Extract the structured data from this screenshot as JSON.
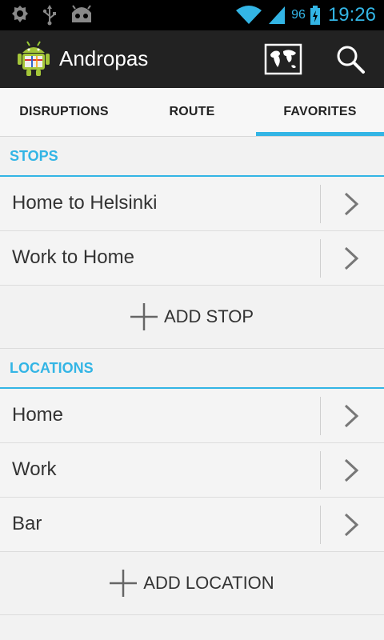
{
  "status_bar": {
    "icons": [
      "settings-gear-icon",
      "usb-icon",
      "android-robot-icon",
      "wifi-icon",
      "signal-icon",
      "battery-charging-icon"
    ],
    "battery": "96",
    "time": "19:26"
  },
  "action_bar": {
    "title": "Andropas",
    "actions": [
      "map-icon",
      "search-icon"
    ]
  },
  "tabs": [
    {
      "label": "DISRUPTIONS",
      "active": false
    },
    {
      "label": "ROUTE",
      "active": false
    },
    {
      "label": "FAVORITES",
      "active": true
    }
  ],
  "stops": {
    "header": "STOPS",
    "items": [
      {
        "label": "Home to Helsinki"
      },
      {
        "label": "Work to Home"
      }
    ],
    "add_label": "ADD STOP"
  },
  "locations": {
    "header": "LOCATIONS",
    "items": [
      {
        "label": "Home"
      },
      {
        "label": "Work"
      },
      {
        "label": "Bar"
      }
    ],
    "add_label": "ADD LOCATION"
  },
  "colors": {
    "accent": "#33b5e5",
    "action_bar_bg": "#222222",
    "status_bar_bg": "#000000"
  }
}
